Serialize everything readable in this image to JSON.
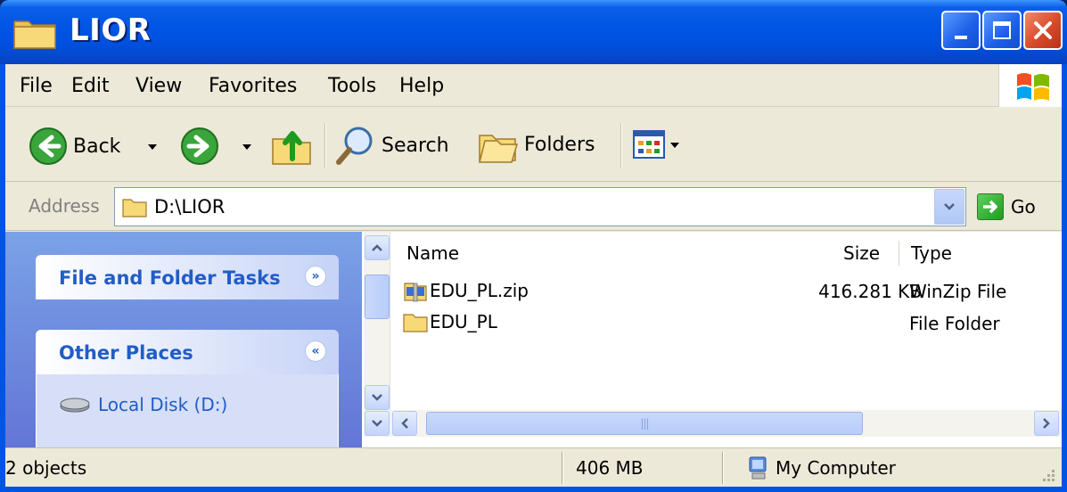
{
  "window": {
    "title": "LIOR"
  },
  "menubar": {
    "items": [
      "File",
      "Edit",
      "View",
      "Favorites",
      "Tools",
      "Help"
    ]
  },
  "toolbar": {
    "back_label": "Back",
    "search_label": "Search",
    "folders_label": "Folders"
  },
  "address": {
    "label": "Address",
    "value": "D:\\LIOR",
    "go_label": "Go"
  },
  "taskpane": {
    "sections": [
      {
        "title": "File and Folder Tasks",
        "state": "expand"
      },
      {
        "title": "Other Places",
        "state": "collapse"
      }
    ],
    "other_places_links": [
      "Local Disk (D:)"
    ]
  },
  "filelist": {
    "columns": [
      "Name",
      "Size",
      "Type"
    ],
    "rows": [
      {
        "name": "EDU_PL.zip",
        "size": "416.281 KB",
        "type": "WinZip File",
        "icon": "zip-file-icon"
      },
      {
        "name": "EDU_PL",
        "size": "",
        "type": "File Folder",
        "icon": "folder-icon"
      }
    ]
  },
  "statusbar": {
    "objects": "2 objects",
    "size": "406 MB",
    "location": "My Computer"
  },
  "colors": {
    "titlebar": "#0054e3",
    "taskpane_link": "#215dc6",
    "frame": "#ece9d8"
  }
}
